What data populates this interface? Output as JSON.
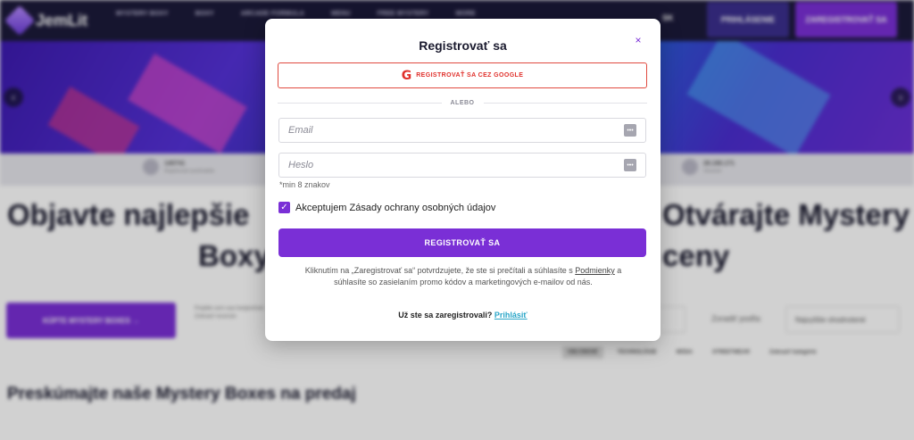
{
  "background": {
    "logo_text": "JemLit",
    "nav_items": [
      "MYSTERY BOXY",
      "BOXY",
      "ARCADE FORMULA",
      "MENU",
      "FREE MYSTERY",
      "MORE"
    ],
    "language": "SK",
    "login_label": "PRIHLÁSENIE",
    "register_label": "ZAREGISTROVAŤ SA",
    "stats": [
      {
        "value": "140741",
        "label": "Registrovaní používatelia"
      },
      {
        "value": "29.190.171",
        "label": "Otvorené"
      }
    ],
    "headline_left": "Objavte najlepšie",
    "headline_right": "Otvárajte Mystery",
    "headline2_left": "Boxy",
    "headline2_right": "ceny",
    "buy_button": "KÚPTE MYSTERY BOXES →",
    "side_copy": "Prejdite sem vasi kedykoľvek Zobraziť recenzie",
    "sort_label": "Zoradiť podľa:",
    "sort_value": "Najvyššie ohodnotené",
    "filters": [
      "OBĽÚBENÉ",
      "TECHNOLÓGIE",
      "MÓDA",
      "STREETWEAR",
      "Zobraziť kategórie"
    ],
    "section_title": "Preskúmajte naše Mystery Boxes na predaj"
  },
  "modal": {
    "title": "Registrovať sa",
    "close_symbol": "×",
    "google_label": "REGISTROVAŤ SA CEZ GOOGLE",
    "divider_text": "ALEBO",
    "email_placeholder": "Email",
    "password_placeholder": "Heslo",
    "password_hint": "*min 8 znakov",
    "consent_label": "Akceptujem Zásady ochrany osobných údajov",
    "consent_checked": true,
    "submit_label": "REGISTROVAŤ SA",
    "legal_pre": "Kliknutím na „Zaregistrovať sa“ potvrdzujete, že ste si prečítali a súhlasíte s",
    "legal_link": "Podmienky",
    "legal_post": "a súhlasíte so zasielaním promo kódov a marketingových e-mailov od nás.",
    "already_text": "Už ste sa zaregistrovali?",
    "login_link": "Prihlásiť"
  },
  "colors": {
    "accent": "#7a2fd6",
    "google_red": "#e0302b",
    "link_blue": "#2aa6c8",
    "topbar": "#1c1a3a"
  }
}
